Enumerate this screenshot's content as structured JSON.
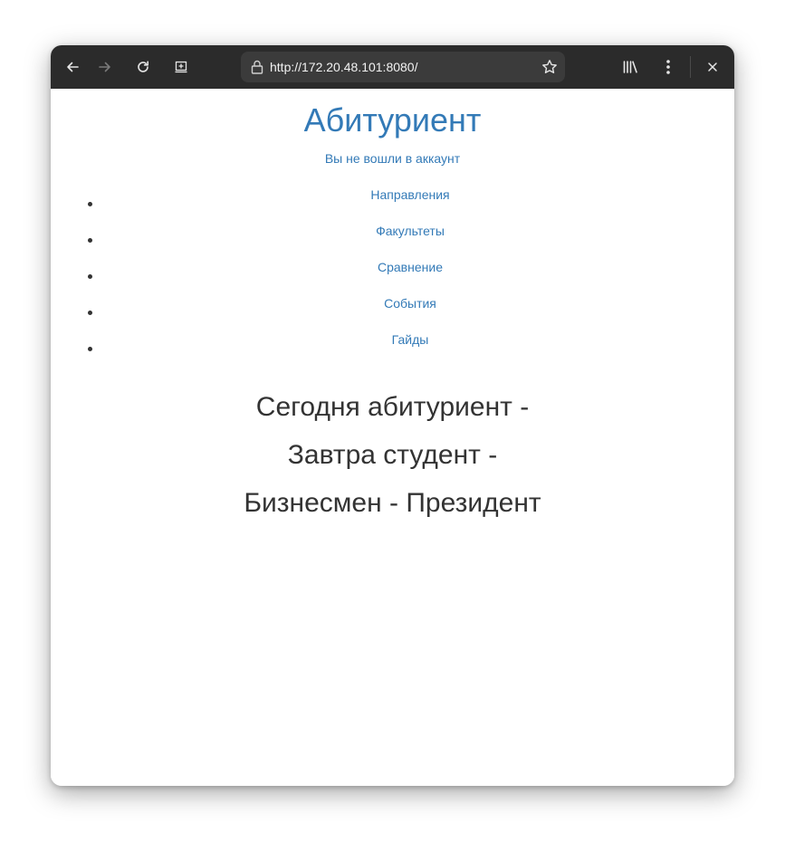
{
  "browser": {
    "url": "http://172.20.48.101:8080/",
    "icons": {
      "back": "arrow-left-icon",
      "forward": "arrow-right-icon",
      "reload": "reload-icon",
      "screenshot": "screenshot-icon",
      "lock": "lock-icon",
      "bookmark": "star-icon",
      "library": "library-icon",
      "menu": "kebab-menu-icon",
      "close": "close-icon"
    },
    "colors": {
      "toolbar": "#2b2b2b",
      "urlbar": "#3b3b3b",
      "icon": "#e6e6e6",
      "icon_disabled": "#7a7a7a"
    }
  },
  "page": {
    "title": "Абитуриент",
    "login_status": "Вы не вошли в аккаунт",
    "nav": [
      {
        "label": "Направления"
      },
      {
        "label": "Факультеты"
      },
      {
        "label": "Сравнение"
      },
      {
        "label": "События"
      },
      {
        "label": "Гайды"
      }
    ],
    "slogan": [
      "Сегодня абитуриент -",
      "Завтра студент -",
      "Бизнесмен - Президент"
    ],
    "colors": {
      "link": "#337ab7",
      "text": "#333333"
    }
  }
}
